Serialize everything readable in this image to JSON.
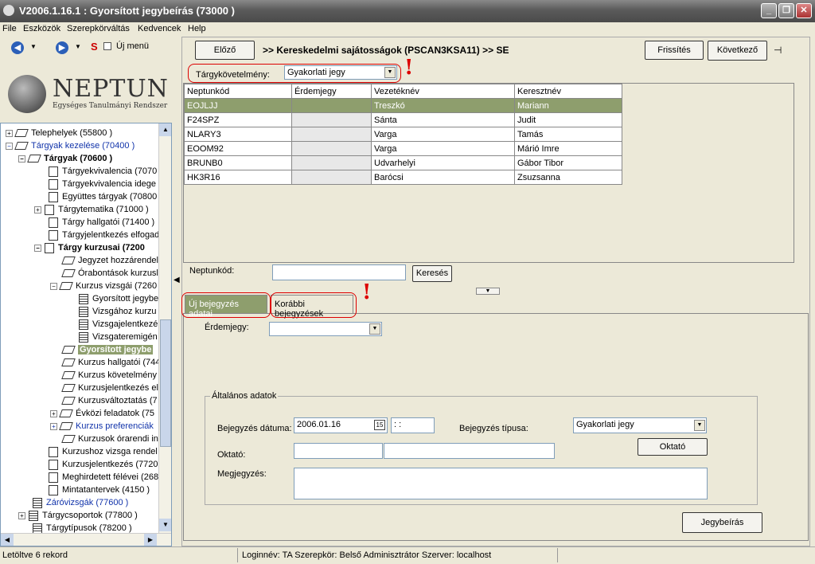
{
  "window": {
    "title": "V2006.1.16.1 : Gyorsított jegybeírás (73000  )"
  },
  "menu": [
    "File",
    "Eszközök",
    "Szerepkörváltás",
    "Kedvencek",
    "Help"
  ],
  "toolbar": {
    "new_menu_label": "Új menü"
  },
  "logo": {
    "name": "NEPTUN",
    "subtitle": "Egységes Tanulmányi Rendszer"
  },
  "tree": [
    {
      "label": "Telephelyek (55800  )"
    },
    {
      "label": "Tárgyak kezelése (70400  )"
    },
    {
      "label": "Tárgyak (70600  )"
    },
    {
      "label": "Tárgyekvivalencia (7070"
    },
    {
      "label": "Tárgyekvivalencia idege"
    },
    {
      "label": "Együttes tárgyak (70800"
    },
    {
      "label": "Tárgytematika (71000  )"
    },
    {
      "label": "Tárgy hallgatói (71400  )"
    },
    {
      "label": "Tárgyjelentkezés elfogad"
    },
    {
      "label": "Tárgy kurzusai (7200"
    },
    {
      "label": "Jegyzet hozzárendel"
    },
    {
      "label": "Órabontások kurzusl"
    },
    {
      "label": "Kurzus vizsgái (7260"
    },
    {
      "label": "Gyorsított jegybe"
    },
    {
      "label": "Vizsgához kurzu"
    },
    {
      "label": "Vizsgajelentkezé"
    },
    {
      "label": "Vizsgateremigén"
    },
    {
      "label": "Gyorsított jegybe"
    },
    {
      "label": "Kurzus hallgatói (744"
    },
    {
      "label": "Kurzus követelmény"
    },
    {
      "label": "Kurzusjelentkezés el"
    },
    {
      "label": "Kurzusváltoztatás (7"
    },
    {
      "label": "Évközi feladatok (75"
    },
    {
      "label": "Kurzus preferenciák"
    },
    {
      "label": "Kurzusok órarendi in"
    },
    {
      "label": "Kurzushoz vizsga rendel"
    },
    {
      "label": "Kurzusjelentkezés (7720"
    },
    {
      "label": "Meghirdetett félévei (268"
    },
    {
      "label": "Mintatantervek (4150  )"
    },
    {
      "label": "Záróvizsgák (77600  )"
    },
    {
      "label": "Tárgycsoportok (77800  )"
    },
    {
      "label": "Tárgytípusok (78200  )"
    }
  ],
  "header": {
    "prev_label": "Előző",
    "breadcrumb": ">> Kereskedelmi sajátosságok (PSCAN3KSA11) >> SE",
    "refresh_label": "Frissítés",
    "next_label": "Következő"
  },
  "requirement": {
    "label": "Tárgykövetelmény:",
    "value": "Gyakorlati jegy"
  },
  "table": {
    "columns": [
      "Neptunkód",
      "Érdemjegy",
      "Vezetéknév",
      "Keresztnév"
    ],
    "rows": [
      [
        "EOJLJJ",
        "",
        "Treszkó",
        "Mariann"
      ],
      [
        "F24SPZ",
        "",
        "Sánta",
        "Judit"
      ],
      [
        "NLARY3",
        "",
        "Varga",
        "Tamás"
      ],
      [
        "EOOM92",
        "",
        "Varga",
        "Márió Imre"
      ],
      [
        "BRUNB0",
        "",
        "Udvarhelyi",
        "Gábor Tibor"
      ],
      [
        "HK3R16",
        "",
        "Barócsi",
        "Zsuzsanna"
      ]
    ]
  },
  "search": {
    "label": "Neptunkód:",
    "value": "",
    "button": "Keresés"
  },
  "tabs": [
    "Új bejegyzés adatai",
    "Korábbi bejegyzések"
  ],
  "form": {
    "grade_label": "Érdemjegy:",
    "grade_value": "",
    "group_title": "Általános adatok",
    "date_label": "Bejegyzés dátuma:",
    "date_value": "2006.01.16",
    "time_value": " :  :",
    "type_label": "Bejegyzés típusa:",
    "type_value": "Gyakorlati jegy",
    "teacher_button": "Oktató",
    "teacher_label": "Oktató:",
    "note_label": "Megjegyzés:",
    "submit": "Jegybeírás"
  },
  "status": {
    "records": "Letöltve 6 rekord",
    "user": "Loginnév: TA   Szerepkör: Belső Adminisztrátor   Szerver: localhost"
  }
}
